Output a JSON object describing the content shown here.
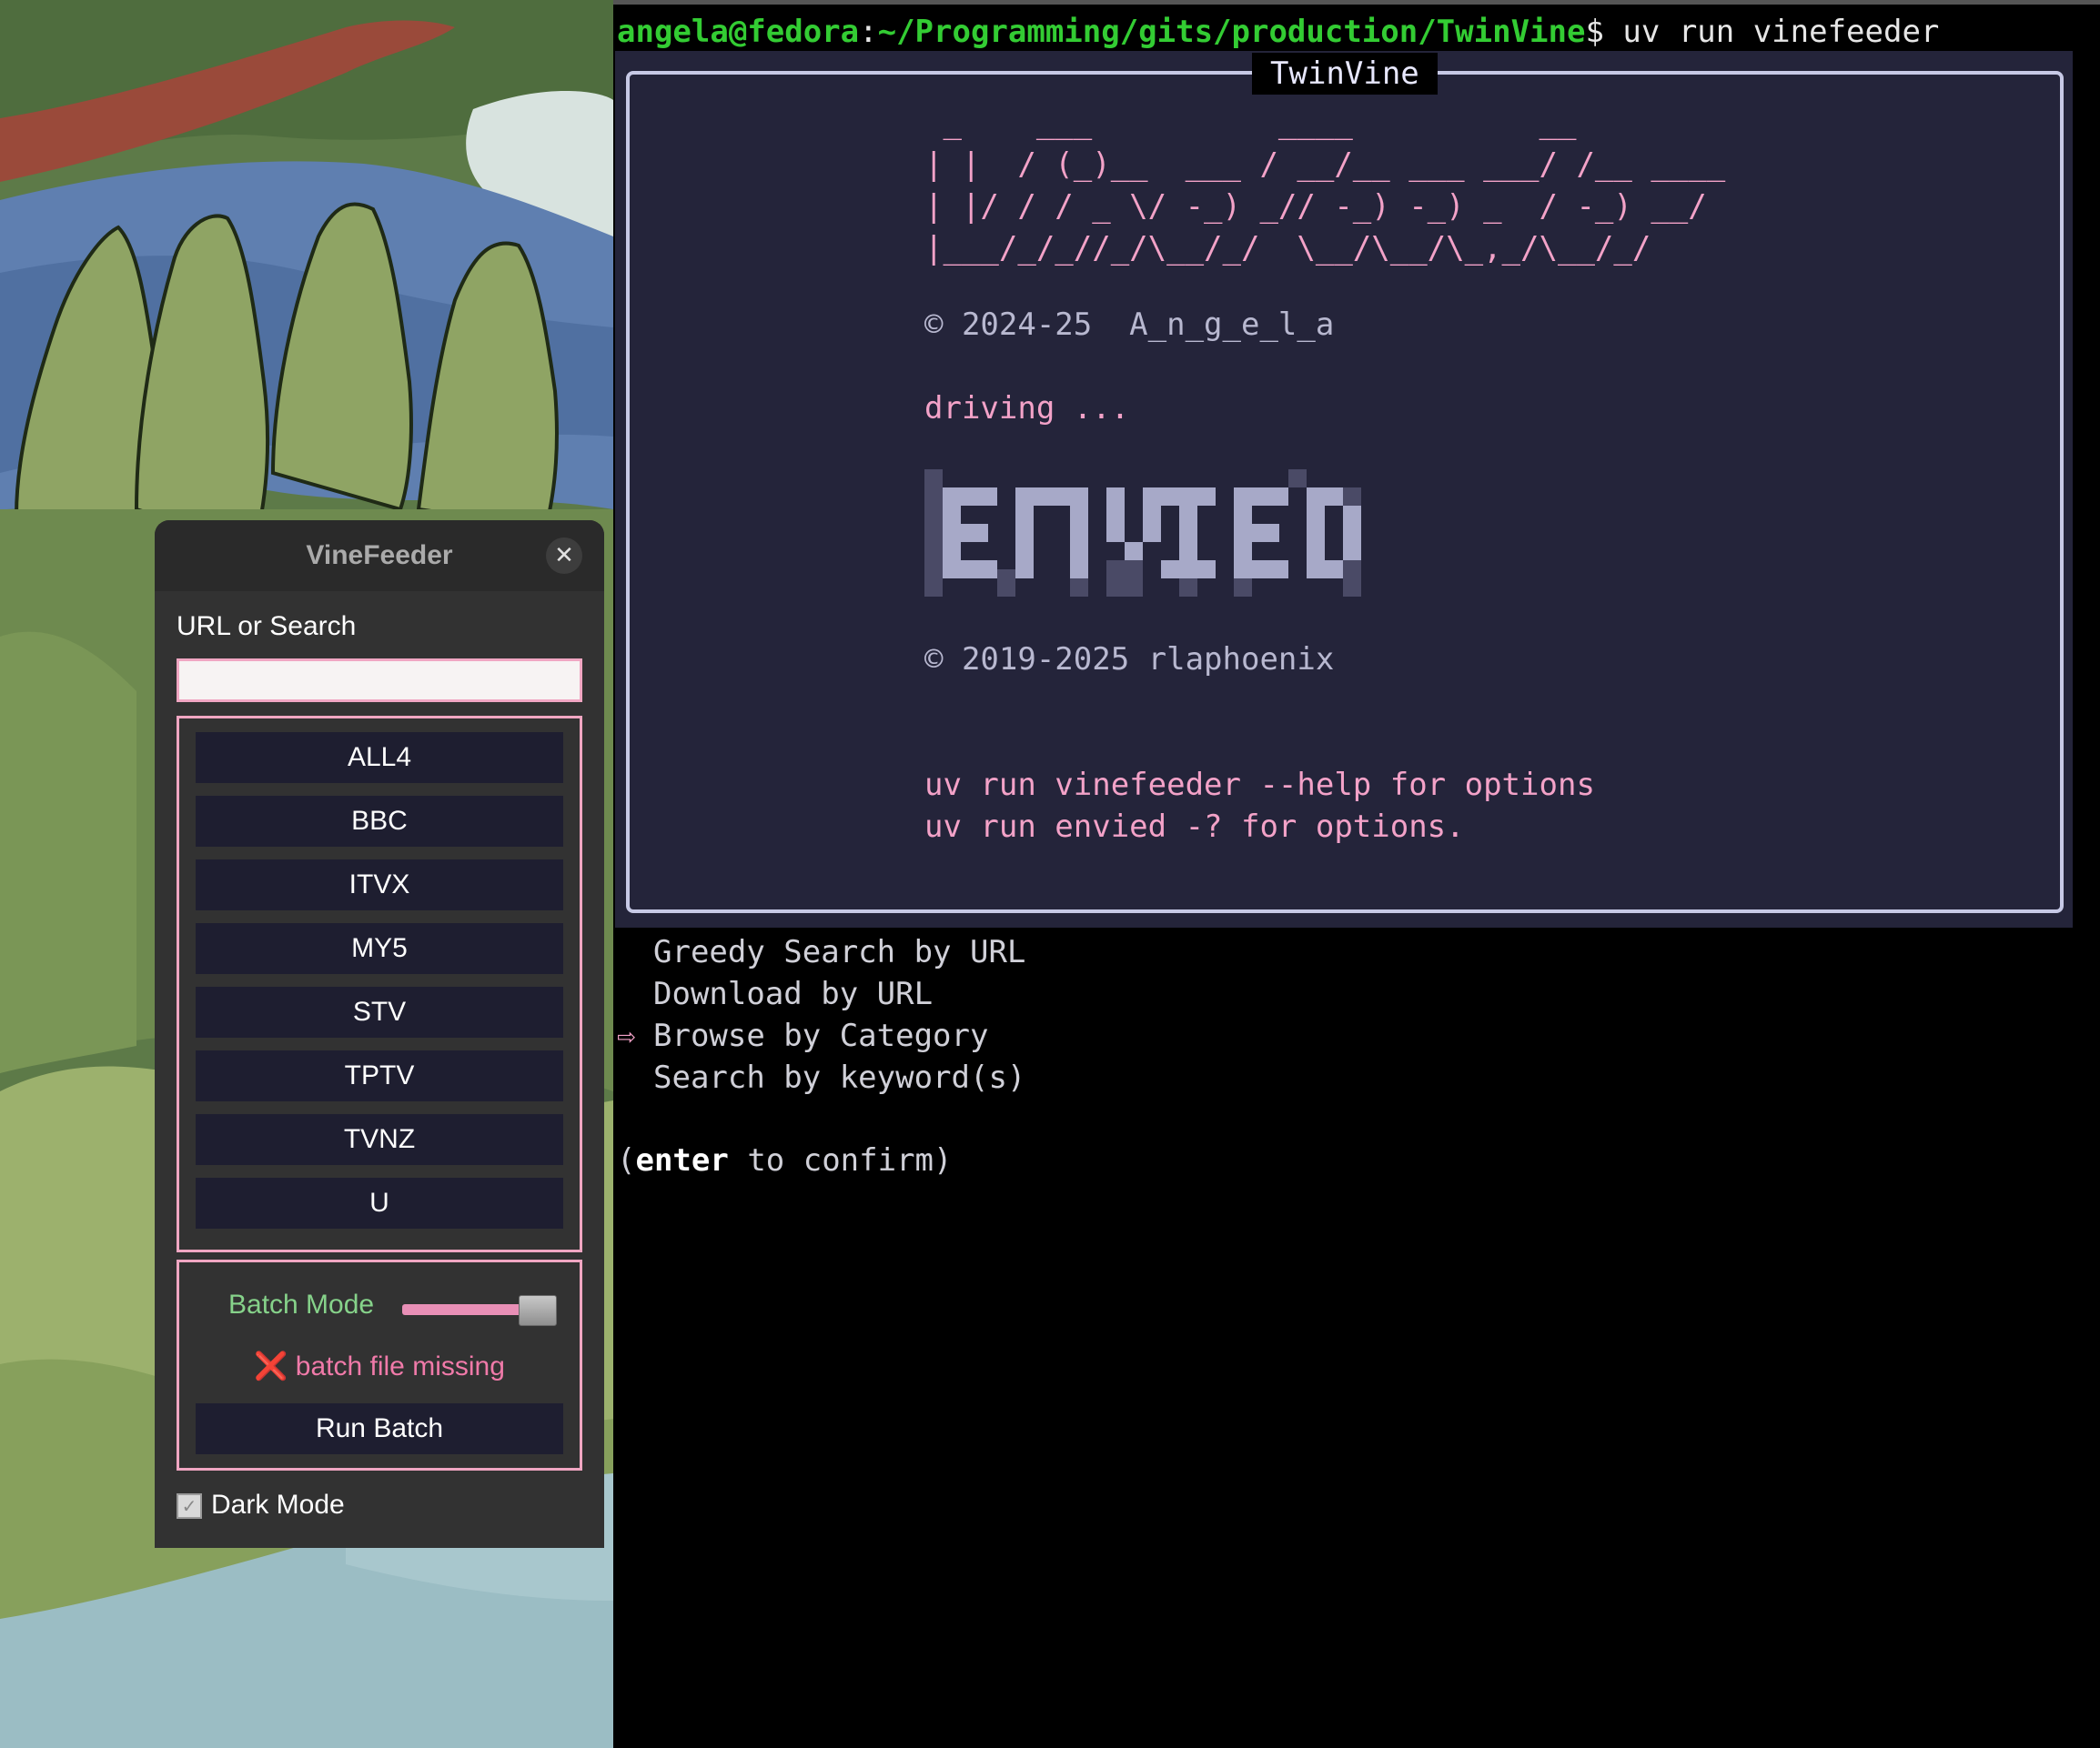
{
  "terminal": {
    "prompt_user_host": "angela@fedora",
    "prompt_sep": ":",
    "prompt_path": "~/Programming/gits/production/TwinVine",
    "prompt_symbol": "$ ",
    "command": "uv run vinefeeder",
    "panel": {
      "title": "TwinVine",
      "ascii_art": " _    ___          ____          __\n| |  / (_)__  ___ / __/__ ___ ___/ /__ ____\n| |/ / / _ \\/ -_) _// -_) -_) _  / -_) __/\n|___/_/_//_/\\__/_/  \\__/\\__/\\_,_/\\__/_/",
      "copyright_1": "© 2024-25  A_n_g_e_l_a",
      "driving": "driving ...",
      "logo_name": "ENVIED",
      "copyright_2": "© 2019-2025 rlaphoenix",
      "help_1": "uv run vinefeeder --help for options",
      "help_2": "uv run envied -? for options."
    },
    "menu": {
      "items": [
        "Greedy Search by URL",
        "Download by URL",
        "Browse by Category",
        "Search by keyword(s)"
      ],
      "selected_index": 2,
      "selected_marker": "⇨",
      "confirm_open": "(",
      "confirm_key": "enter",
      "confirm_rest": " to confirm)"
    }
  },
  "vinefeeder": {
    "title": "VineFeeder",
    "close_glyph": "✕",
    "url_label": "URL or Search",
    "url_value": "",
    "channels": [
      "ALL4",
      "BBC",
      "ITVX",
      "MY5",
      "STV",
      "TPTV",
      "TVNZ",
      "U"
    ],
    "batch_mode_label": "Batch Mode",
    "batch_mode_on": true,
    "batch_status_icon": "❌",
    "batch_status": "batch file missing",
    "run_batch_label": "Run Batch",
    "dark_mode_label": "Dark Mode",
    "dark_mode_checked": true
  },
  "colors": {
    "accent_pink": "#f0a6c2",
    "prompt_green": "#33cc33",
    "panel_bg": "#24243a",
    "button_bg": "#1e1e30",
    "batch_green": "#86d28a"
  }
}
